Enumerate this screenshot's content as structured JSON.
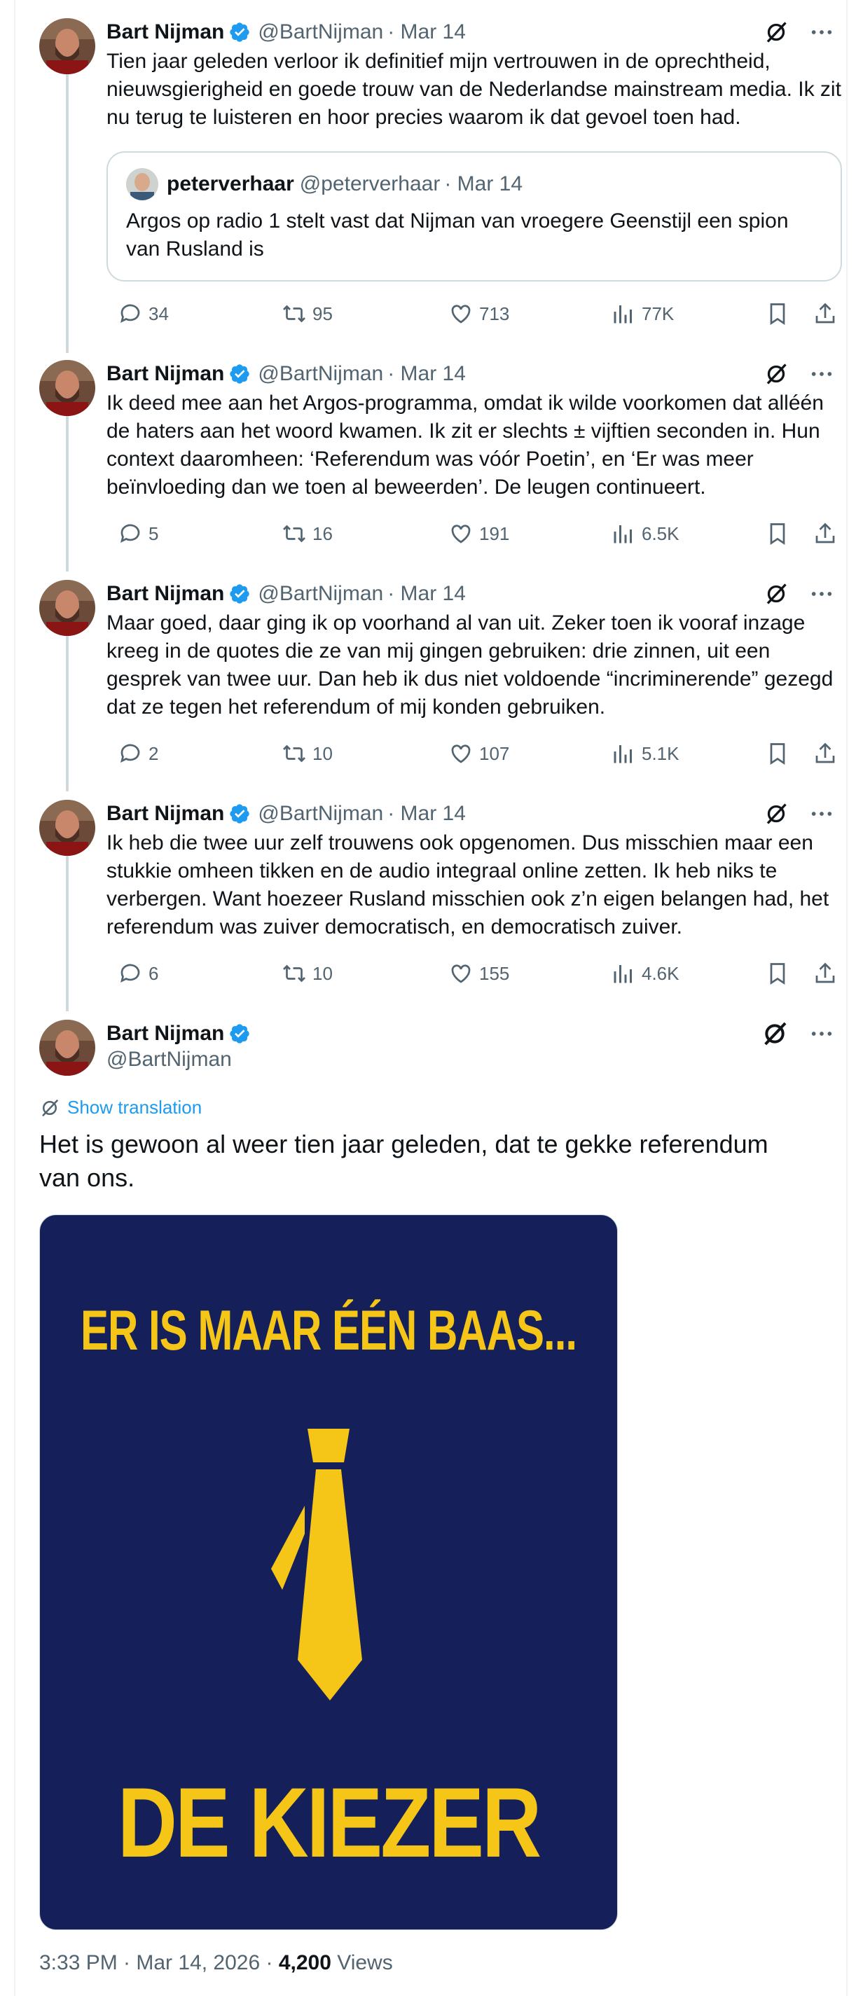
{
  "colors": {
    "accent": "#1d9bf0",
    "muted": "#536471",
    "text": "#0f1419",
    "poster_bg": "#15205a",
    "poster_fg": "#f5c518"
  },
  "icons": [
    "verified-badge-icon",
    "grok-icon",
    "more-icon",
    "reply-icon",
    "repost-icon",
    "like-icon",
    "views-icon",
    "bookmark-icon",
    "share-icon",
    "translate-icon"
  ],
  "tweets": [
    {
      "name": "Bart Nijman",
      "handle": "@BartNijman",
      "date": "· Mar 14",
      "text": "Tien jaar geleden verloor ik definitief mijn vertrouwen in de oprechtheid, nieuwsgierigheid en goede trouw van de Nederlandse mainstream media. Ik zit nu terug te luisteren en hoor precies waarom ik dat gevoel toen had.",
      "quote": {
        "name": "peterverhaar",
        "handle": "@peterverhaar",
        "date": "· Mar 14",
        "text": "Argos op radio 1 stelt vast dat Nijman van vroegere Geenstijl een spion van Rusland is"
      },
      "replies": "34",
      "reposts": "95",
      "likes": "713",
      "views": "77K"
    },
    {
      "name": "Bart Nijman",
      "handle": "@BartNijman",
      "date": "· Mar 14",
      "text": "Ik deed mee aan het Argos-programma, omdat ik wilde voorkomen dat alléén de haters aan het woord kwamen. Ik zit er slechts ± vijftien seconden in. Hun context daaromheen: ‘Referendum was vóór Poetin’, en ‘Er was meer beïnvloeding dan we toen al beweerden’. De leugen continueert.",
      "replies": "5",
      "reposts": "16",
      "likes": "191",
      "views": "6.5K"
    },
    {
      "name": "Bart Nijman",
      "handle": "@BartNijman",
      "date": "· Mar 14",
      "text": "Maar goed, daar ging ik op voorhand al van uit. Zeker toen ik vooraf inzage kreeg in de quotes die ze van mij gingen gebruiken: drie zinnen, uit een gesprek van twee uur. Dan heb ik dus niet voldoende “incriminerende” gezegd dat ze tegen het referendum of mij konden gebruiken.",
      "replies": "2",
      "reposts": "10",
      "likes": "107",
      "views": "5.1K"
    },
    {
      "name": "Bart Nijman",
      "handle": "@BartNijman",
      "date": "· Mar 14",
      "text": "Ik heb die twee uur zelf trouwens ook opgenomen. Dus misschien maar een stukkie omheen tikken en de audio integraal online zetten. Ik heb niks te verbergen. Want hoezeer Rusland misschien ook z’n eigen belangen had, het referendum was zuiver democratisch, en democratisch zuiver.",
      "replies": "6",
      "reposts": "10",
      "likes": "155",
      "views": "4.6K"
    }
  ],
  "main_tweet": {
    "name": "Bart Nijman",
    "handle": "@BartNijman",
    "show_translation": "Show translation",
    "text": "Het is gewoon al weer tien jaar geleden, dat te gekke referendum van ons.",
    "poster_top": "ER IS MAAR ÉÉN BAAS...",
    "poster_bottom": "DE KIEZER",
    "time": "3:33 PM · Mar 14, 2026 · ",
    "views_count": "4,200",
    "views_label": " Views"
  }
}
